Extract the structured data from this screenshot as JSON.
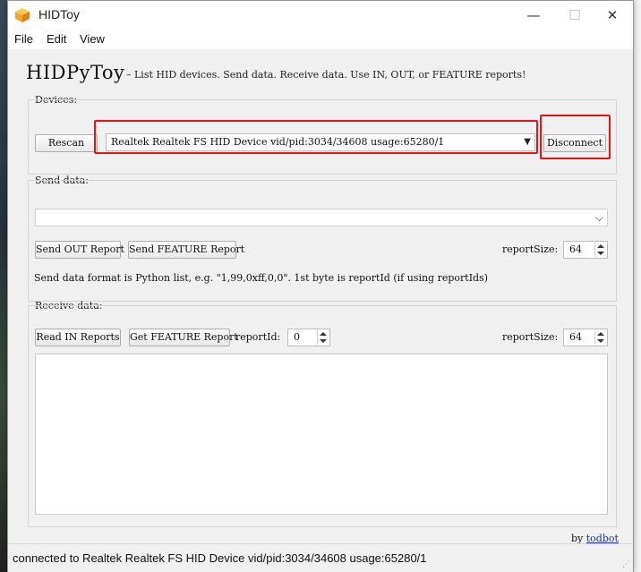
{
  "window": {
    "title": "HIDToy",
    "minimize_glyph": "—",
    "maximize_glyph": "☐",
    "close_glyph": "✕"
  },
  "menu": {
    "items": [
      "File",
      "Edit",
      "View"
    ]
  },
  "header": {
    "title": "HIDPyToy",
    "subtitle": "– List HID devices. Send data. Receive data. Use IN, OUT, or FEATURE reports!"
  },
  "devices": {
    "group_label": "Devices:",
    "rescan_label": "Rescan",
    "selected_device": "Realtek Realtek FS HID Device  vid/pid:3034/34608 usage:65280/1",
    "disconnect_label": "Disconnect"
  },
  "send": {
    "group_label": "Send data:",
    "input_value": "",
    "out_button": "Send OUT Report",
    "feature_button": "Send FEATURE Report",
    "report_size_label": "reportSize:",
    "report_size_value": "64",
    "format_hint": "Send data format is Python list, e.g. \"1,99,0xff,0,0\". 1st byte is reportId (if using reportIds)"
  },
  "receive": {
    "group_label": "Receive data:",
    "read_in_button": "Read IN Reports",
    "get_feature_button": "Get FEATURE Report",
    "report_id_label": "reportId:",
    "report_id_value": "0",
    "report_size_label": "reportSize:",
    "report_size_value": "64",
    "output_text": ""
  },
  "credit": {
    "by": "by",
    "author": "todbot"
  },
  "status": {
    "text": "connected to Realtek Realtek FS HID Device  vid/pid:3034/34608 usage:65280/1"
  },
  "colors": {
    "highlight": "#e8141b",
    "link": "#1f2db0",
    "icon_orange": "#f5a623"
  },
  "icons": {
    "app": "cube-icon",
    "dropdown": "chevron-down-icon"
  }
}
